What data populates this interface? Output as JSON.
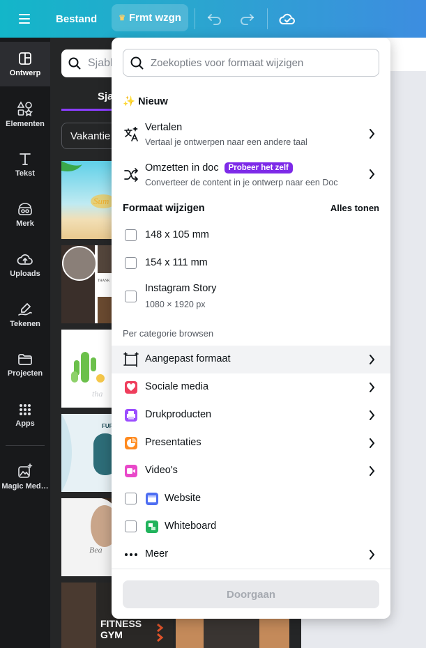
{
  "topbar": {
    "file_label": "Bestand",
    "resize_label": "Frmt wzgn"
  },
  "sidebar": {
    "items": [
      {
        "label": "Ontwerp",
        "icon": "layout-icon"
      },
      {
        "label": "Elementen",
        "icon": "shapes-icon"
      },
      {
        "label": "Tekst",
        "icon": "text-icon"
      },
      {
        "label": "Merk",
        "icon": "brand-icon"
      },
      {
        "label": "Uploads",
        "icon": "cloud-upload-icon"
      },
      {
        "label": "Tekenen",
        "icon": "draw-icon"
      },
      {
        "label": "Projecten",
        "icon": "folder-icon"
      },
      {
        "label": "Apps",
        "icon": "apps-grid-icon"
      },
      {
        "label": "Magic Med…",
        "icon": "magic-media-icon"
      }
    ]
  },
  "panel": {
    "search_placeholder": "Sjabl",
    "tab_label": "Sja",
    "filter_label": "Vakantie"
  },
  "popover": {
    "search_placeholder": "Zoekopties voor formaat wijzigen",
    "new_heading": "✨ Nieuw",
    "translate": {
      "label": "Vertalen",
      "desc": "Vertaal je ontwerpen naar een andere taal"
    },
    "convert": {
      "label": "Omzetten in doc",
      "badge": "Probeer het zelf",
      "desc": "Converteer de content in je ontwerp naar een Doc"
    },
    "resize_heading": "Formaat wijzigen",
    "show_all": "Alles tonen",
    "sizes": [
      {
        "label": "148 x 105 mm",
        "desc": ""
      },
      {
        "label": "154 x 111 mm",
        "desc": ""
      },
      {
        "label": "Instagram Story",
        "desc": "1080 × 1920 px"
      }
    ],
    "browse_heading": "Per categorie browsen",
    "categories": [
      {
        "label": "Aangepast formaat",
        "icon": "custom-size-icon"
      },
      {
        "label": "Sociale media",
        "icon": "heart-icon",
        "color": "#ef3e5c"
      },
      {
        "label": "Drukproducten",
        "icon": "printer-icon",
        "color": "#9b4dff"
      },
      {
        "label": "Presentaties",
        "icon": "presentation-icon",
        "color": "#ff8a1f"
      },
      {
        "label": "Video's",
        "icon": "video-icon",
        "color": "#e948c9"
      }
    ],
    "checkbox_categories": [
      {
        "label": "Website",
        "icon": "website-icon",
        "color": "#4e6ef2"
      },
      {
        "label": "Whiteboard",
        "icon": "whiteboard-icon",
        "color": "#21b35c"
      }
    ],
    "more_label": "Meer",
    "continue_label": "Doorgaan"
  }
}
